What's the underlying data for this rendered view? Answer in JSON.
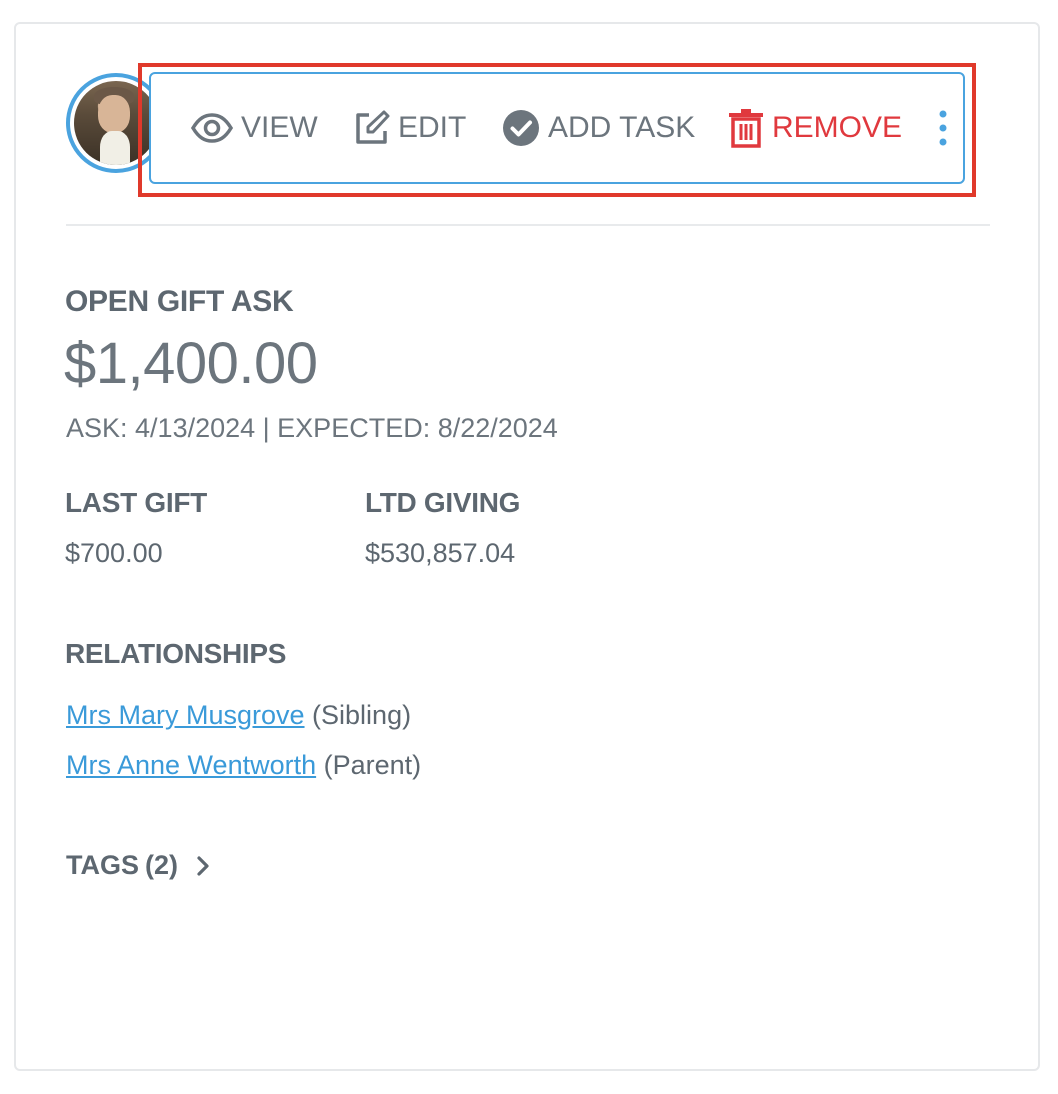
{
  "toolbar": {
    "view_label": "VIEW",
    "edit_label": "EDIT",
    "add_task_label": "ADD TASK",
    "remove_label": "REMOVE"
  },
  "colors": {
    "accent": "#4aa3df",
    "danger": "#e0393e",
    "highlight": "#e0392b",
    "text": "#5d6770",
    "link": "#3a9ad9"
  },
  "ask": {
    "title": "OPEN GIFT ASK",
    "amount": "$1,400.00",
    "dates": "ASK: 4/13/2024 | EXPECTED: 8/22/2024"
  },
  "stats": {
    "last_gift_label": "LAST GIFT",
    "last_gift_value": "$700.00",
    "ltd_label": "LTD GIVING",
    "ltd_value": "$530,857.04"
  },
  "relationships": {
    "title": "RELATIONSHIPS",
    "items": [
      {
        "name": "Mrs Mary Musgrove",
        "relation": "(Sibling)"
      },
      {
        "name": "Mrs Anne Wentworth",
        "relation": "(Parent)"
      }
    ]
  },
  "tags": {
    "label": "TAGS",
    "count": "(2)"
  }
}
